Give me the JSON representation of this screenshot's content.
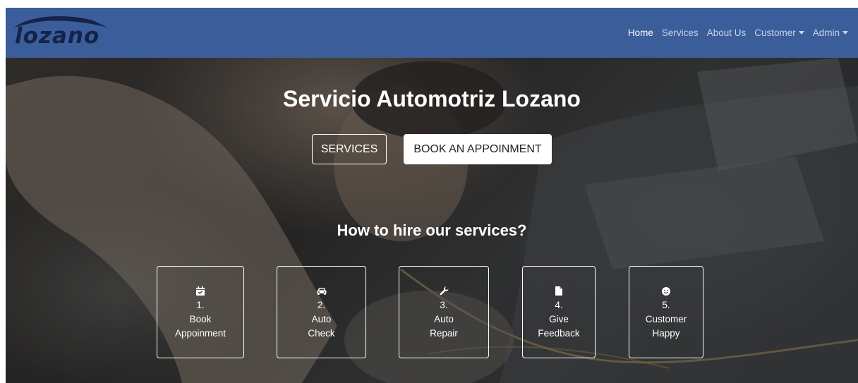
{
  "brand": {
    "name": "lozano"
  },
  "nav": {
    "links": [
      {
        "label": "Home",
        "active": true
      },
      {
        "label": "Services",
        "active": false
      },
      {
        "label": "About Us",
        "active": false
      },
      {
        "label": "Customer",
        "active": false,
        "dropdown": true
      },
      {
        "label": "Admin",
        "active": false,
        "dropdown": true
      }
    ]
  },
  "hero": {
    "title": "Servicio Automotriz Lozano",
    "services_button": "SERVICES",
    "book_button": "BOOK AN APPOINMENT",
    "subtitle": "How to hire our services?"
  },
  "steps": [
    {
      "number": "1.",
      "line1": "Book",
      "line2": "Appoinment",
      "icon": "calendar-check-icon"
    },
    {
      "number": "2.",
      "line1": "Auto",
      "line2": "Check",
      "icon": "car-icon"
    },
    {
      "number": "3.",
      "line1": "Auto",
      "line2": "Repair",
      "icon": "wrench-icon"
    },
    {
      "number": "4.",
      "line1": "Give",
      "line2": "Feedback",
      "icon": "file-icon"
    },
    {
      "number": "5.",
      "line1": "Customer",
      "line2": "Happy",
      "icon": "smile-icon"
    }
  ],
  "colors": {
    "navbar": "#3b5d9a",
    "brand_text": "#15224a",
    "nav_link": "#c7d3ea",
    "nav_link_active": "#ffffff"
  }
}
